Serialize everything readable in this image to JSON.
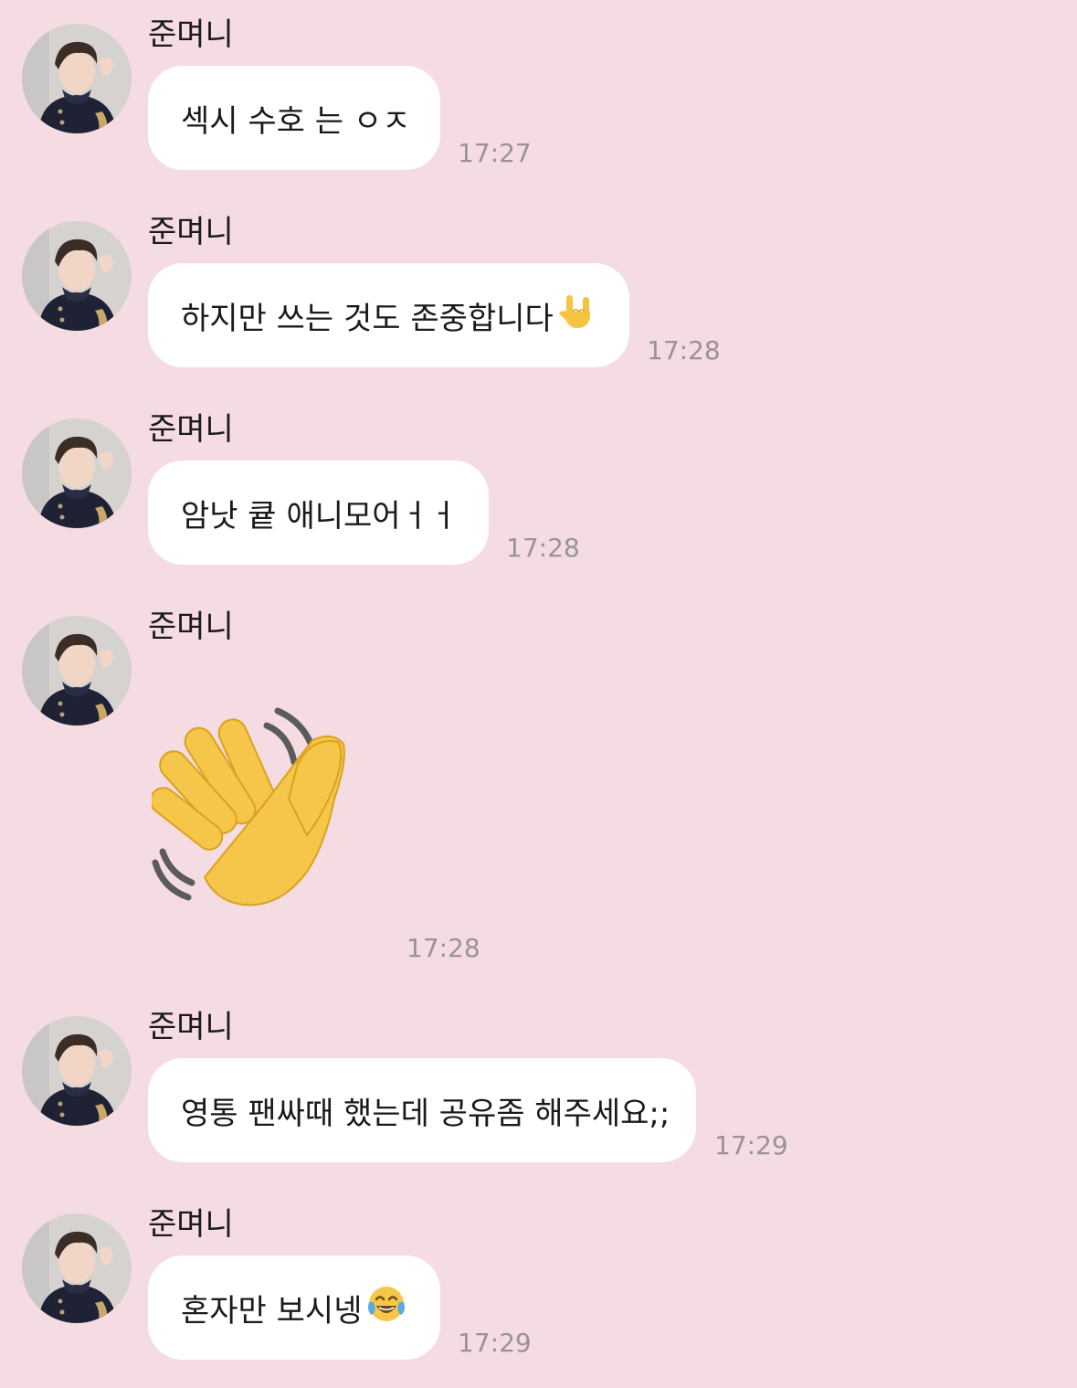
{
  "chat": {
    "background_color": "#f5dce2",
    "bubble_color": "#ffffff",
    "messages": [
      {
        "sender": "준며니",
        "text": "섹시 수호 는 ㅇㅈ",
        "time": "17:27"
      },
      {
        "sender": "준며니",
        "text": "하지만 쓰는 것도 존중합니다",
        "emoji": "love-you-gesture-emoji",
        "time": "17:28"
      },
      {
        "sender": "준며니",
        "text": "암낫 큩 애니모어ㅓㅓ",
        "time": "17:28"
      },
      {
        "sender": "준며니",
        "sticker": "waving-hand-emoji",
        "time": "17:28"
      },
      {
        "sender": "준며니",
        "text": "영통 팬싸때 했는데 공유좀 해주세요;;",
        "time": "17:29"
      },
      {
        "sender": "준며니",
        "text": "혼자만 보시넹",
        "emoji": "tears-of-joy-emoji",
        "time": "17:29"
      }
    ]
  }
}
